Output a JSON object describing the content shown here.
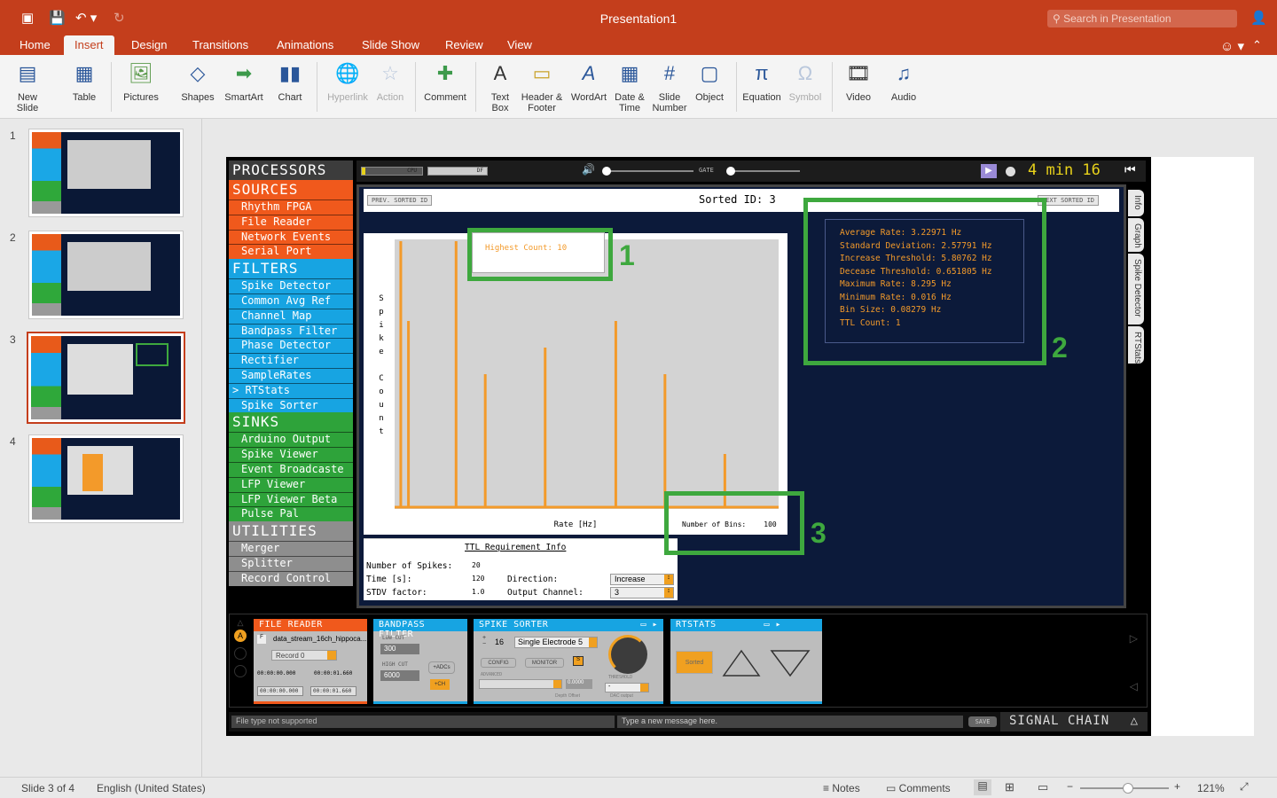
{
  "app": {
    "title": "Presentation1",
    "search_placeholder": "Search in Presentation"
  },
  "tabs": [
    "Home",
    "Insert",
    "Design",
    "Transitions",
    "Animations",
    "Slide Show",
    "Review",
    "View"
  ],
  "ribbon": {
    "new_slide": "New\nSlide",
    "table": "Table",
    "pictures": "Pictures",
    "shapes": "Shapes",
    "smartart": "SmartArt",
    "chart": "Chart",
    "hyperlink": "Hyperlink",
    "action": "Action",
    "comment": "Comment",
    "text_box": "Text\nBox",
    "header_footer": "Header &\nFooter",
    "wordart": "WordArt",
    "date_time": "Date &\nTime",
    "slide_number": "Slide\nNumber",
    "object": "Object",
    "equation": "Equation",
    "symbol": "Symbol",
    "video": "Video",
    "audio": "Audio"
  },
  "slides": [
    "1",
    "2",
    "3",
    "4"
  ],
  "oe": {
    "processors_title": "PROCESSORS",
    "sources_title": "SOURCES",
    "sources": [
      "Rhythm FPGA",
      "File Reader",
      "Network Events",
      "Serial Port"
    ],
    "filters_title": "FILTERS",
    "filters": [
      "Spike Detector",
      "Common Avg Ref",
      "Channel Map",
      "Bandpass Filter",
      "Phase Detector",
      "Rectifier",
      "SampleRates",
      "> RTStats",
      "Spike Sorter"
    ],
    "sinks_title": "SINKS",
    "sinks": [
      "Arduino Output",
      "Spike Viewer",
      "Event Broadcaste",
      "LFP Viewer",
      "LFP Viewer Beta",
      "Pulse Pal"
    ],
    "utilities_title": "UTILITIES",
    "utilities": [
      "Merger",
      "Splitter",
      "Record Control"
    ],
    "cpu_label": "CPU",
    "df_label": "DF",
    "gate_label": "GATE",
    "clock": "4 min 16",
    "prev_sorted": "PREV. SORTED ID",
    "next_sorted": "NEXT SORTED ID",
    "sorted_id": "Sorted ID: 3",
    "side_tabs": [
      "Info",
      "Graph",
      "Spike Detector",
      "RTStats"
    ],
    "highest_count": "Highest Count: 10",
    "y_label": [
      "S",
      "p",
      "i",
      "k",
      "e",
      "",
      "C",
      "o",
      "u",
      "n",
      "t"
    ],
    "x_label": "Rate [Hz]",
    "bins_label": "Number of Bins:",
    "bins_value": "100",
    "stats": [
      "Average Rate: 3.22971 Hz",
      "Standard Deviation: 2.57791 Hz",
      "Increase Threshold: 5.80762 Hz",
      "Decease Threshold: 0.651805 Hz",
      "Maximum Rate: 8.295 Hz",
      "Minimum Rate: 0.016 Hz",
      "Bin Size: 0.08279 Hz",
      "TTL Count: 1"
    ],
    "ttl": {
      "title": "TTL Requirement Info",
      "spikes_label": "Number of Spikes:",
      "spikes_value": "20",
      "time_label": "Time [s]:",
      "time_value": "120",
      "stdv_label": "STDV factor:",
      "stdv_value": "1.0",
      "direction_label": "Direction:",
      "direction_value": "Increase",
      "channel_label": "Output Channel:",
      "channel_value": "3"
    },
    "annotations": [
      "1",
      "2",
      "3"
    ],
    "signal_chain": "SIGNAL CHAIN",
    "nodes": {
      "file_reader": {
        "title": "FILE READER",
        "file": "data_stream_16ch_hippoca...",
        "record": "Record 0",
        "t1": "00:00:00.000",
        "t2": "00:00:01.660",
        "t3": "00:00:00.000",
        "t4": "00:00:01.660"
      },
      "bandpass": {
        "title": "BANDPASS FILTER",
        "low_label": "LOW CUT",
        "low": "300",
        "high_label": "HIGH CUT",
        "high": "6000",
        "adcs": "+ADCs",
        "ch": "+CH"
      },
      "spike_sorter": {
        "title": "SPIKE SORTER",
        "count": "16",
        "electrode": "Single Electrode 5",
        "config": "CONFIG",
        "monitor": "MONITOR",
        "s": "S",
        "advanced": "ADVANCED",
        "depth_value": "0.0000",
        "depth_label": "Depth Offset",
        "dac_label": "DAC output",
        "threshold": "THRESHOLD",
        "dac_value": "-"
      },
      "rtstats": {
        "title": "RTSTATS",
        "sorted": "Sorted"
      }
    },
    "status_msg": "File type not supported",
    "message_placeholder": "Type a new message here.",
    "save": "SAVE"
  },
  "status": {
    "slide": "Slide 3 of 4",
    "language": "English (United States)",
    "notes": "Notes",
    "comments": "Comments",
    "zoom": "121%"
  },
  "chart_data": {
    "type": "bar",
    "x": [
      0.4,
      0.9,
      4.0,
      5.9,
      9.8,
      14.4,
      17.6,
      21.5
    ],
    "values": [
      10,
      7,
      10,
      5,
      6,
      7,
      5,
      2
    ],
    "xlabel": "Rate [Hz]",
    "ylabel": "Spike Count",
    "ylim": [
      0,
      10
    ],
    "color": "#f39a2a"
  }
}
